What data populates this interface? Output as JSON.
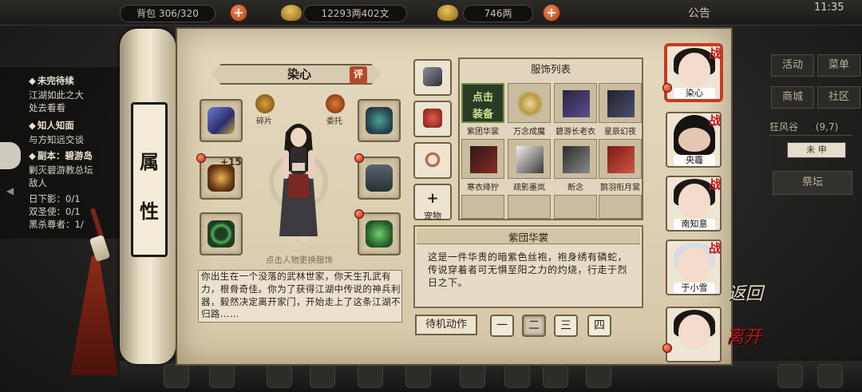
{
  "topbar": {
    "inventory": "背包 306/320",
    "silver": "12293两402文",
    "gold": "746两",
    "notice": "公告",
    "clock": "11:35"
  },
  "quests": {
    "head1": "未完待续",
    "line1": "江湖如此之大",
    "line2": "处去看看",
    "head2": "知人知面",
    "line3": "与方知远交谈",
    "head3": "副本：碧游岛",
    "line4": "剿灭碧游教总坛",
    "line5": "敌人",
    "line6": "日下影：0/1",
    "line7": "双圣使：0/1",
    "line8": "黑杀尊者：1/"
  },
  "side_menu": {
    "activity": "活动",
    "menu": "菜单",
    "shop": "商城",
    "community": "社区",
    "location": "狂风谷",
    "location_coord": "(9,7)",
    "time": "未 申",
    "altar": "祭坛"
  },
  "scroll": {
    "attr_char1": "属",
    "attr_char2": "性"
  },
  "character": {
    "name": "染心",
    "rate": "评",
    "fragments": "碎片",
    "entrust": "委托",
    "weapon_plus": "+15",
    "change_hint": "点击人物更换服饰",
    "bio": "你出生在一个没落的武林世家，你天生孔武有力，根骨奇佳。你为了获得江湖中传说的神兵利器，毅然决定离开家门，开始走上了这条江湖不归路……"
  },
  "categories": {
    "pet": "宠物",
    "pet_plus": "+"
  },
  "costume_list": {
    "title": "服饰列表",
    "equip_line1": "点击",
    "equip_line2": "装备",
    "items": [
      {
        "name": "紫团华裳"
      },
      {
        "name": "万念成魔"
      },
      {
        "name": "碧游长老衣"
      },
      {
        "name": "星辰幻夜"
      },
      {
        "name": "寒衣绛狞"
      },
      {
        "name": "疏影墨岚"
      },
      {
        "name": "断念"
      },
      {
        "name": "鹊羽衔月裳"
      }
    ]
  },
  "detail": {
    "title": "紫団华裳",
    "text": "这是一件华贵的暗紫色丝袍，袍身绣有磷蛇，传说穿着者可无惧至阳之力的灼烧，行走于烈日之下。"
  },
  "idle": {
    "label": "待机动作",
    "btn1": "一",
    "btn2": "二",
    "btn3": "三",
    "btn4": "四"
  },
  "companions": {
    "battle_tag": "战",
    "c1": "染心",
    "c2": "央霾",
    "c3": "南知意",
    "c4": "于小雪"
  },
  "nav": {
    "back": "返回",
    "leave": "离开"
  },
  "colors": {
    "accent_red": "#c3121c",
    "parchment": "#ddd1b4",
    "equip_green": "#c6e58c"
  }
}
